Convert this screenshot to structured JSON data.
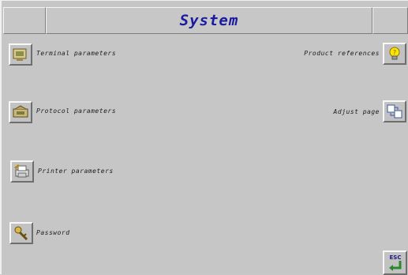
{
  "header": {
    "title": "System"
  },
  "left_menu": [
    {
      "label": "Terminal parameters",
      "icon": "terminal-icon"
    },
    {
      "label": "Protocol parameters",
      "icon": "protocol-icon"
    },
    {
      "label": "Printer parameters",
      "icon": "printer-icon"
    },
    {
      "label": "Password",
      "icon": "key-icon"
    }
  ],
  "right_menu": [
    {
      "label": "Product references",
      "icon": "lightbulb-icon"
    },
    {
      "label": "Adjust page",
      "icon": "adjust-page-icon"
    }
  ],
  "footer": {
    "esc_label": "ESC",
    "esc_icon": "return-arrow-icon"
  }
}
